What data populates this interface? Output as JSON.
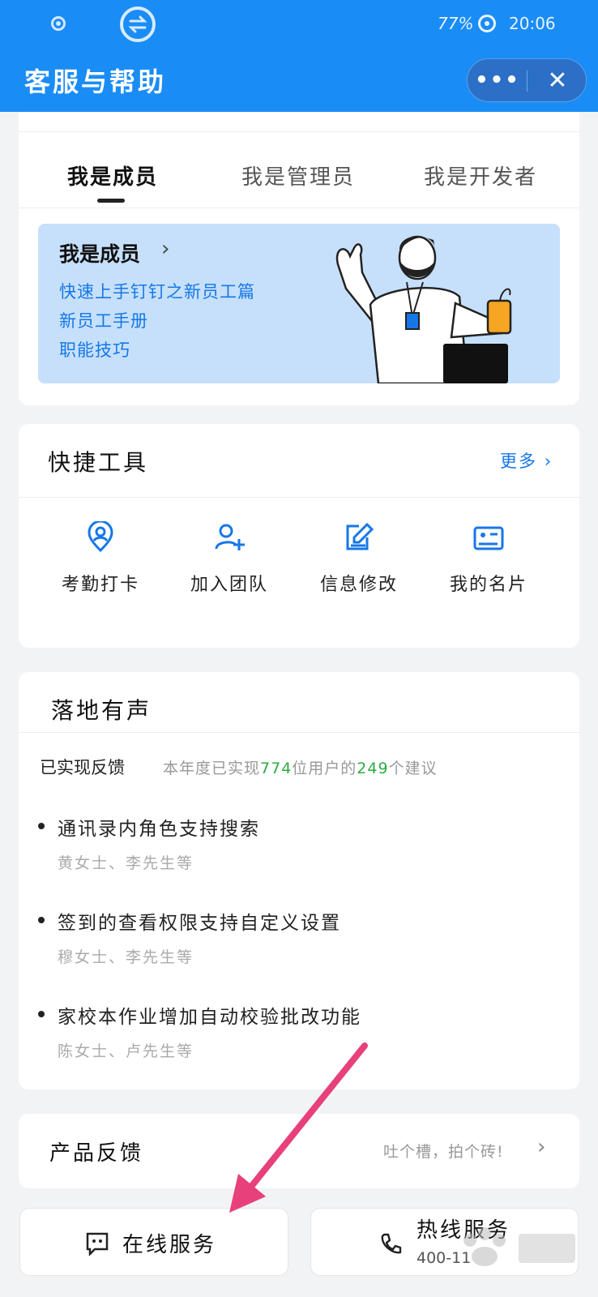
{
  "status_bar": {
    "battery": "77%",
    "time": "20:06"
  },
  "header": {
    "title": "客服与帮助",
    "more_icon": "more-dots-icon",
    "close_icon": "close-icon"
  },
  "tabs": [
    {
      "label": "我是成员",
      "active": true
    },
    {
      "label": "我是管理员",
      "active": false
    },
    {
      "label": "我是开发者",
      "active": false
    }
  ],
  "banner": {
    "title": "我是成员",
    "links": [
      "快速上手钉钉之新员工篇",
      "新员工手册",
      "职能技巧"
    ]
  },
  "quick_tools": {
    "title": "快捷工具",
    "more": "更多",
    "items": [
      {
        "label": "考勤打卡",
        "icon": "location-pin-icon"
      },
      {
        "label": "加入团队",
        "icon": "add-user-icon"
      },
      {
        "label": "信息修改",
        "icon": "edit-icon"
      },
      {
        "label": "我的名片",
        "icon": "card-icon"
      }
    ]
  },
  "feedback": {
    "title": "落地有声",
    "subtitle": "已实现反馈",
    "note_prefix": "本年度已实现",
    "users": "774",
    "note_middle": "位用户的",
    "suggestions": "249",
    "note_suffix": "个建议",
    "items": [
      {
        "text": "通讯录内角色支持搜索",
        "users": "黄女士、李先生等"
      },
      {
        "text": "签到的查看权限支持自定义设置",
        "users": "穆女士、李先生等"
      },
      {
        "text": "家校本作业增加自动校验批改功能",
        "users": "陈女士、卢先生等"
      }
    ]
  },
  "product_feedback": {
    "title": "产品反馈",
    "hint": "吐个槽，拍个砖!"
  },
  "bottom_buttons": {
    "online": "在线服务",
    "hotline": "热线服务",
    "hotline_number": "400-11"
  },
  "colors": {
    "header_blue": "#1a8cf5",
    "link_blue": "#1677e8",
    "green": "#2bab43",
    "arrow_pink": "#e8407a"
  }
}
